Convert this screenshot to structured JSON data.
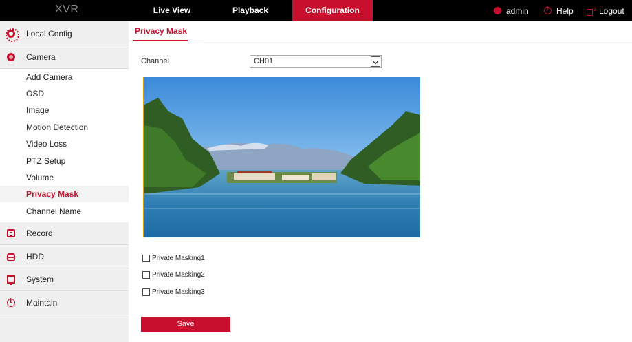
{
  "header": {
    "logo": "XVR",
    "tabs": [
      {
        "label": "Live View"
      },
      {
        "label": "Playback"
      },
      {
        "label": "Configuration",
        "active": true
      }
    ],
    "user_label": "admin",
    "help_label": "Help",
    "logout_label": "Logout"
  },
  "sidebar": {
    "sections": [
      {
        "label": "Local Config",
        "icon": "gear-icon"
      },
      {
        "label": "Camera",
        "icon": "camera-icon",
        "expanded": true
      },
      {
        "label": "Record",
        "icon": "record-icon"
      },
      {
        "label": "HDD",
        "icon": "hdd-icon"
      },
      {
        "label": "System",
        "icon": "monitor-icon"
      },
      {
        "label": "Maintain",
        "icon": "info-icon"
      }
    ],
    "camera_items": [
      {
        "label": "Add Camera"
      },
      {
        "label": "OSD"
      },
      {
        "label": "Image"
      },
      {
        "label": "Motion Detection"
      },
      {
        "label": "Video Loss"
      },
      {
        "label": "PTZ Setup"
      },
      {
        "label": "Volume"
      },
      {
        "label": "Privacy Mask",
        "active": true
      },
      {
        "label": "Channel Name"
      }
    ]
  },
  "main": {
    "page_tab": "Privacy Mask",
    "channel_label": "Channel",
    "channel_value": "CH01",
    "masks": [
      {
        "label": "Private Masking1",
        "checked": false
      },
      {
        "label": "Private Masking2",
        "checked": false
      },
      {
        "label": "Private Masking3",
        "checked": false
      }
    ],
    "save_label": "Save"
  },
  "colors": {
    "accent": "#c8102e",
    "topbar": "#000000",
    "sidebar_bg": "#f0f0f0"
  }
}
